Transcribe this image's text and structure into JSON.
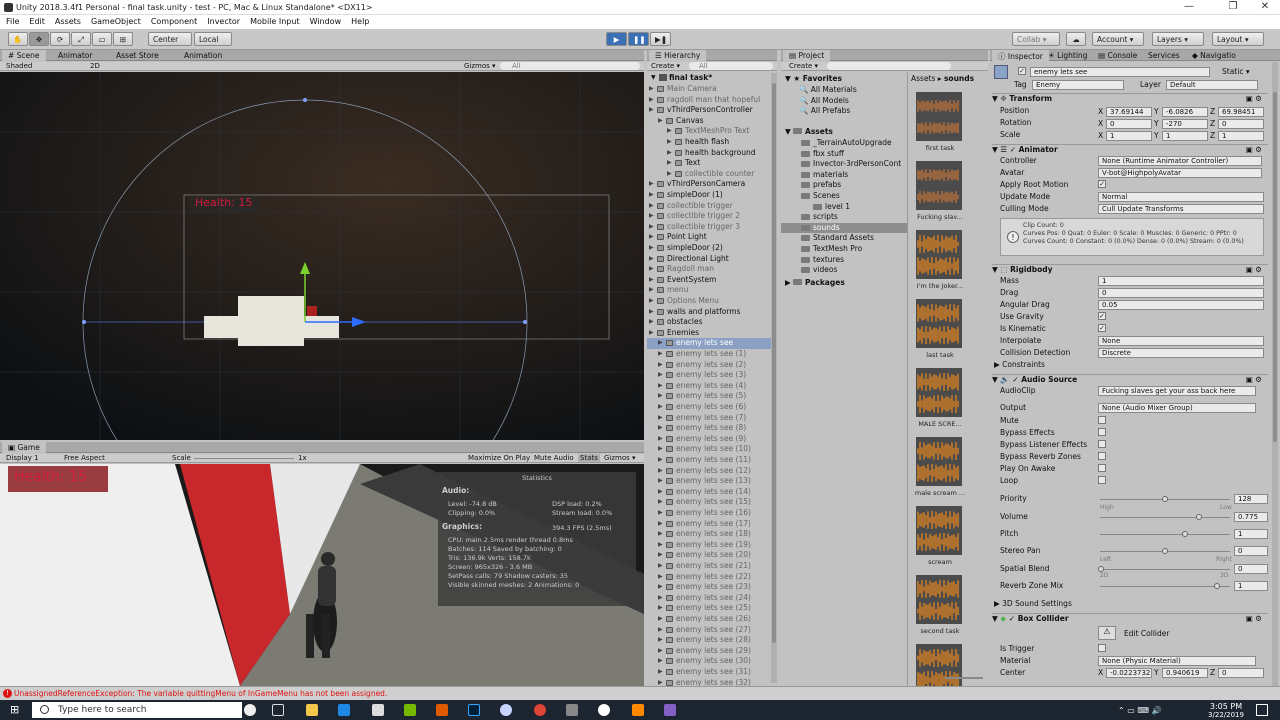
{
  "window": {
    "title": "Unity 2018.3.4f1 Personal - final task.unity - test - PC, Mac & Linux Standalone* <DX11>",
    "min": "—",
    "max": "❐",
    "close": "✕"
  },
  "menu": [
    "File",
    "Edit",
    "Assets",
    "GameObject",
    "Component",
    "Invector",
    "Mobile Input",
    "Window",
    "Help"
  ],
  "toolbar": {
    "center": "Center",
    "local": "Local",
    "collab": "Collab ▾",
    "account": "Account ▾",
    "layers": "Layers ▾",
    "layout": "Layout ▾"
  },
  "scene": {
    "tabs": [
      "Scene",
      "Animator",
      "Asset Store",
      "Animation"
    ],
    "shading": "Shaded",
    "mode2d": "2D",
    "gizmos": "Gizmos ▾",
    "search": "All",
    "health": "Health: 15"
  },
  "game": {
    "tab": "Game",
    "display": "Display 1",
    "aspect": "Free Aspect",
    "scale_label": "Scale",
    "scale_val": "1x",
    "maximize": "Maximize On Play",
    "mute": "Mute Audio",
    "stats": "Stats",
    "gizmos": "Gizmos ▾",
    "health": "Health: 15"
  },
  "stats": {
    "title": "Statistics",
    "audio": "Audio:",
    "level": "Level: -74.8 dB",
    "clipping": "Clipping: 0.0%",
    "dsp": "DSP load: 0.2%",
    "stream": "Stream load: 0.0%",
    "graphics": "Graphics:",
    "fps": "394.3 FPS (2.5ms)",
    "cpu": "CPU: main 2.5ms   render thread 0.8ms",
    "batches": "Batches: 114    Saved by batching: 0",
    "tris": "Tris: 136.9k         Verts: 158.7k",
    "screen": "Screen: 965x326 - 3.6 MB",
    "setpass": "SetPass calls: 79    Shadow casters: 35",
    "skinned": "Visible skinned meshes: 2   Animations: 0"
  },
  "hierarchy": {
    "tab": "Hierarchy",
    "create": "Create ▾",
    "search": "All",
    "scene": "final task*",
    "rows": [
      {
        "t": "Main Camera",
        "d": 1,
        "dim": true
      },
      {
        "t": "ragdoll man that hopeful",
        "d": 1,
        "dim": true
      },
      {
        "t": "vThirdPersonController",
        "d": 1
      },
      {
        "t": "Canvas",
        "d": 2
      },
      {
        "t": "TextMeshPro Text",
        "d": 3,
        "dim": true
      },
      {
        "t": "health flash",
        "d": 3
      },
      {
        "t": "health background",
        "d": 3
      },
      {
        "t": "Text",
        "d": 3
      },
      {
        "t": "collectible counter",
        "d": 3,
        "dim": true
      },
      {
        "t": "vThirdPersonCamera",
        "d": 1
      },
      {
        "t": "simpleDoor (1)",
        "d": 1
      },
      {
        "t": "collectible trigger",
        "d": 1,
        "dim": true
      },
      {
        "t": "collectible trigger 2",
        "d": 1,
        "dim": true
      },
      {
        "t": "collectible trigger 3",
        "d": 1,
        "dim": true
      },
      {
        "t": "Point Light",
        "d": 1
      },
      {
        "t": "simpleDoor (2)",
        "d": 1
      },
      {
        "t": "Directional Light",
        "d": 1
      },
      {
        "t": "Ragdoll man",
        "d": 1,
        "dim": true
      },
      {
        "t": "EventSystem",
        "d": 1
      },
      {
        "t": "menu",
        "d": 1,
        "dim": true
      },
      {
        "t": "Options Menu",
        "d": 1,
        "dim": true
      },
      {
        "t": "walls and platforms",
        "d": 1
      },
      {
        "t": "obstacles",
        "d": 1
      },
      {
        "t": "Enemies",
        "d": 1
      },
      {
        "t": "enemy lets see",
        "d": 2,
        "sel": true
      },
      {
        "t": "enemy lets see (1)",
        "d": 2,
        "dim": true
      },
      {
        "t": "enemy lets see (2)",
        "d": 2,
        "dim": true
      },
      {
        "t": "enemy lets see (3)",
        "d": 2,
        "dim": true
      },
      {
        "t": "enemy lets see (4)",
        "d": 2,
        "dim": true
      },
      {
        "t": "enemy lets see (5)",
        "d": 2,
        "dim": true
      },
      {
        "t": "enemy lets see (6)",
        "d": 2,
        "dim": true
      },
      {
        "t": "enemy lets see (7)",
        "d": 2,
        "dim": true
      },
      {
        "t": "enemy lets see (8)",
        "d": 2,
        "dim": true
      },
      {
        "t": "enemy lets see (9)",
        "d": 2,
        "dim": true
      },
      {
        "t": "enemy lets see (10)",
        "d": 2,
        "dim": true
      },
      {
        "t": "enemy lets see (11)",
        "d": 2,
        "dim": true
      },
      {
        "t": "enemy lets see (12)",
        "d": 2,
        "dim": true
      },
      {
        "t": "enemy lets see (13)",
        "d": 2,
        "dim": true
      },
      {
        "t": "enemy lets see (14)",
        "d": 2,
        "dim": true
      },
      {
        "t": "enemy lets see (15)",
        "d": 2,
        "dim": true
      },
      {
        "t": "enemy lets see (16)",
        "d": 2,
        "dim": true
      },
      {
        "t": "enemy lets see (17)",
        "d": 2,
        "dim": true
      },
      {
        "t": "enemy lets see (18)",
        "d": 2,
        "dim": true
      },
      {
        "t": "enemy lets see (19)",
        "d": 2,
        "dim": true
      },
      {
        "t": "enemy lets see (20)",
        "d": 2,
        "dim": true
      },
      {
        "t": "enemy lets see (21)",
        "d": 2,
        "dim": true
      },
      {
        "t": "enemy lets see (22)",
        "d": 2,
        "dim": true
      },
      {
        "t": "enemy lets see (23)",
        "d": 2,
        "dim": true
      },
      {
        "t": "enemy lets see (24)",
        "d": 2,
        "dim": true
      },
      {
        "t": "enemy lets see (25)",
        "d": 2,
        "dim": true
      },
      {
        "t": "enemy lets see (26)",
        "d": 2,
        "dim": true
      },
      {
        "t": "enemy lets see (27)",
        "d": 2,
        "dim": true
      },
      {
        "t": "enemy lets see (28)",
        "d": 2,
        "dim": true
      },
      {
        "t": "enemy lets see (29)",
        "d": 2,
        "dim": true
      },
      {
        "t": "enemy lets see (30)",
        "d": 2,
        "dim": true
      },
      {
        "t": "enemy lets see (31)",
        "d": 2,
        "dim": true
      },
      {
        "t": "enemy lets see (32)",
        "d": 2,
        "dim": true
      }
    ]
  },
  "project": {
    "tab": "Project",
    "create": "Create ▾",
    "breadcrumb": [
      "Assets",
      "sounds"
    ],
    "favorites": {
      "label": "Favorites",
      "items": [
        "All Materials",
        "All Models",
        "All Prefabs"
      ]
    },
    "assets_label": "Assets",
    "tree": [
      {
        "t": "_TerrainAutoUpgrade",
        "d": 1
      },
      {
        "t": "fbx stuff",
        "d": 1
      },
      {
        "t": "Invector-3rdPersonCont",
        "d": 1
      },
      {
        "t": "materials",
        "d": 1
      },
      {
        "t": "prefabs",
        "d": 1
      },
      {
        "t": "Scenes",
        "d": 1
      },
      {
        "t": "level 1",
        "d": 2
      },
      {
        "t": "scripts",
        "d": 1
      },
      {
        "t": "sounds",
        "d": 1,
        "sel": true
      },
      {
        "t": "Standard Assets",
        "d": 1
      },
      {
        "t": "TextMesh Pro",
        "d": 1
      },
      {
        "t": "textures",
        "d": 1
      },
      {
        "t": "videos",
        "d": 1
      }
    ],
    "packages": "Packages",
    "files": [
      {
        "name": "first task",
        "orange": false
      },
      {
        "name": "Fucking slav...",
        "orange": false
      },
      {
        "name": "I'm the Joker...",
        "orange": true
      },
      {
        "name": "last task",
        "orange": true
      },
      {
        "name": "MALE SCRE...",
        "orange": true
      },
      {
        "name": "male scream ...",
        "orange": true
      },
      {
        "name": "scream",
        "orange": true
      },
      {
        "name": "second task",
        "orange": true
      },
      {
        "name": "",
        "orange": true
      }
    ]
  },
  "inspector": {
    "tabs": [
      "Inspector",
      "Lighting",
      "Console",
      "Services",
      "Navigatio"
    ],
    "name": "enemy lets see",
    "static": "Static ▾",
    "tag_label": "Tag",
    "tag": "Enemy",
    "layer_label": "Layer",
    "layer": "Default",
    "transform": {
      "title": "Transform",
      "position": {
        "label": "Position",
        "x": "37.69144",
        "y": "-6.0826",
        "z": "69.98451"
      },
      "rotation": {
        "label": "Rotation",
        "x": "0",
        "y": "-270",
        "z": "0"
      },
      "scale": {
        "label": "Scale",
        "x": "1",
        "y": "1",
        "z": "1"
      }
    },
    "animator": {
      "title": "Animator",
      "controller_label": "Controller",
      "controller": "None (Runtime Animator Controller)",
      "avatar_label": "Avatar",
      "avatar": "V-bot@HighpolyAvatar",
      "root_label": "Apply Root Motion",
      "update_label": "Update Mode",
      "update": "Normal",
      "culling_label": "Culling Mode",
      "culling": "Cull Update Transforms",
      "info": "Clip Count: 0\nCurves Pos: 0 Quat: 0 Euler: 0 Scale: 0 Muscles: 0 Generic: 0 PPtr: 0\nCurves Count: 0 Constant: 0 (0.0%) Dense: 0 (0.0%) Stream: 0 (0.0%)"
    },
    "rigidbody": {
      "title": "Rigidbody",
      "mass_label": "Mass",
      "mass": "1",
      "drag_label": "Drag",
      "drag": "0",
      "adrag_label": "Angular Drag",
      "adrag": "0.05",
      "grav_label": "Use Gravity",
      "kin_label": "Is Kinematic",
      "interp_label": "Interpolate",
      "interp": "None",
      "coll_label": "Collision Detection",
      "coll": "Discrete",
      "constraints": "Constraints"
    },
    "audio": {
      "title": "Audio Source",
      "clip_label": "AudioClip",
      "clip": "Fucking slaves get your ass back here",
      "output_label": "Output",
      "output": "None (Audio Mixer Group)",
      "mute": "Mute",
      "bypass_fx": "Bypass Effects",
      "bypass_listener": "Bypass Listener Effects",
      "bypass_reverb": "Bypass Reverb Zones",
      "play_awake": "Play On Awake",
      "loop": "Loop",
      "priority_label": "Priority",
      "priority": "128",
      "high": "High",
      "low": "Low",
      "volume_label": "Volume",
      "volume": "0.775",
      "pitch_label": "Pitch",
      "pitch": "1",
      "pan_label": "Stereo Pan",
      "pan": "0",
      "left": "Left",
      "right": "Right",
      "blend_label": "Spatial Blend",
      "blend": "0",
      "d2": "2D",
      "d3": "3D",
      "reverb_label": "Reverb Zone Mix",
      "reverb": "1",
      "sound3d": "3D Sound Settings"
    },
    "box": {
      "title": "Box Collider",
      "edit": "Edit Collider",
      "trigger_label": "Is Trigger",
      "material_label": "Material",
      "material": "None (Physic Material)",
      "center_label": "Center",
      "cx": "-0.0223732",
      "cy": "0.940619",
      "cz": "0"
    }
  },
  "status": {
    "error": "UnassignedReferenceException: The variable quittingMenu of InGameMenu has not been assigned."
  },
  "taskbar": {
    "search": "Type here to search",
    "time": "3:05 PM",
    "date": "3/22/2019"
  },
  "colors": {
    "accent": "#3b6fb6",
    "error": "#d11",
    "health": "#d11a3c"
  }
}
